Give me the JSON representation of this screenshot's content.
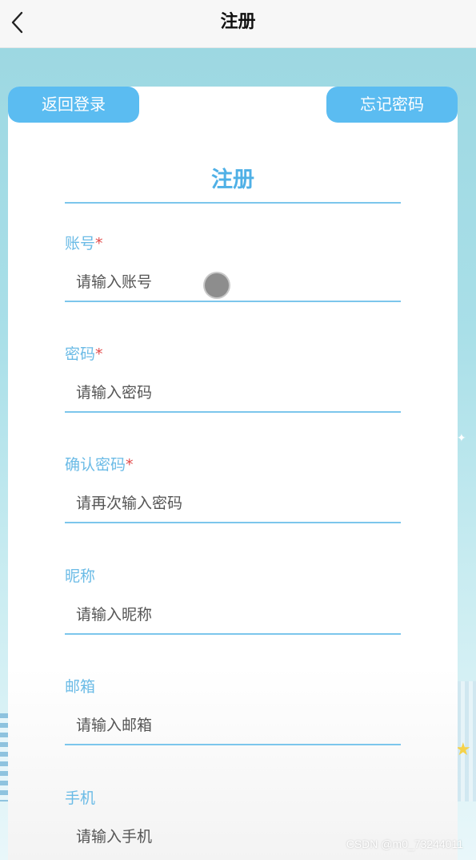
{
  "navbar": {
    "back_icon": "chevron-left-icon",
    "title": "注册"
  },
  "card": {
    "back_to_login_label": "返回登录",
    "forgot_password_label": "忘记密码",
    "form_title": "注册",
    "fields": [
      {
        "label": "账号",
        "required_mark": "*",
        "placeholder": "请输入账号"
      },
      {
        "label": "密码",
        "required_mark": "*",
        "placeholder": "请输入密码"
      },
      {
        "label": "确认密码",
        "required_mark": "*",
        "placeholder": "请再次输入密码"
      },
      {
        "label": "昵称",
        "required_mark": "",
        "placeholder": "请输入昵称"
      },
      {
        "label": "邮箱",
        "required_mark": "",
        "placeholder": "请输入邮箱"
      },
      {
        "label": "手机",
        "required_mark": "",
        "placeholder": "请输入手机"
      }
    ]
  },
  "watermark": "CSDN @m0_73244011",
  "colors": {
    "accent": "#5bbcf1",
    "label": "#6bbbe6",
    "required": "#e24a4a",
    "background_top": "#9dd8e2"
  }
}
